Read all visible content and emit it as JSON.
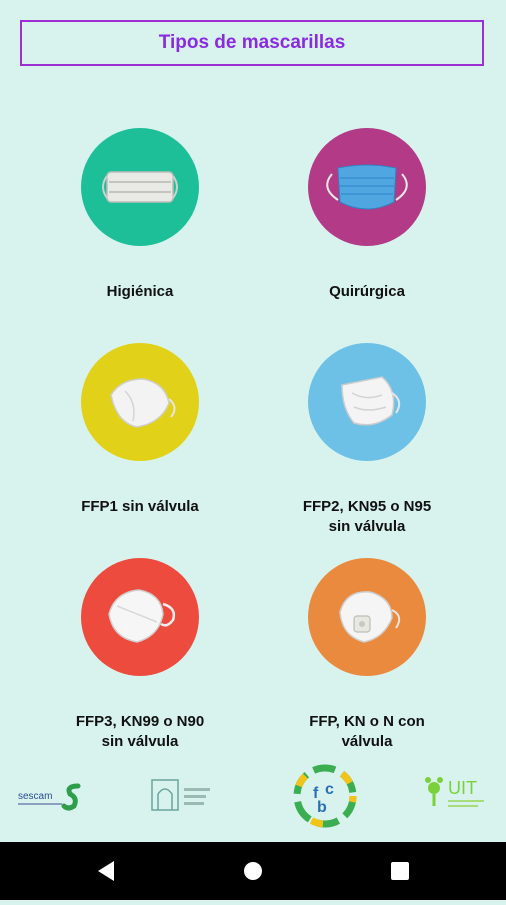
{
  "header": {
    "title": "Tipos de mascarillas"
  },
  "items": [
    {
      "label": "Higiénica",
      "icon": "cloth-mask-icon",
      "color": "#1cbf98"
    },
    {
      "label": "Quirúrgica",
      "icon": "surgical-mask-icon",
      "color": "#b23a86"
    },
    {
      "label": "FFP1 sin válvula",
      "icon": "ffp1-mask-icon",
      "color": "#e1d118"
    },
    {
      "label_line1": "FFP2, KN95 o N95",
      "label_line2": "sin válvula",
      "icon": "ffp2-mask-icon",
      "color": "#6ec1e6"
    },
    {
      "label_line1": "FFP3, KN99 o N90",
      "label_line2": "sin válvula",
      "icon": "ffp3-mask-icon",
      "color": "#ec4b3d"
    },
    {
      "label_line1": "FFP, KN o N con",
      "label_line2": "válvula",
      "icon": "valve-mask-icon",
      "color": "#ea8a3e"
    }
  ],
  "logos": {
    "sescam": "sescam",
    "uit": "UIT"
  },
  "colors": {
    "background": "#d8f3ee",
    "accent": "#8a2be2"
  }
}
